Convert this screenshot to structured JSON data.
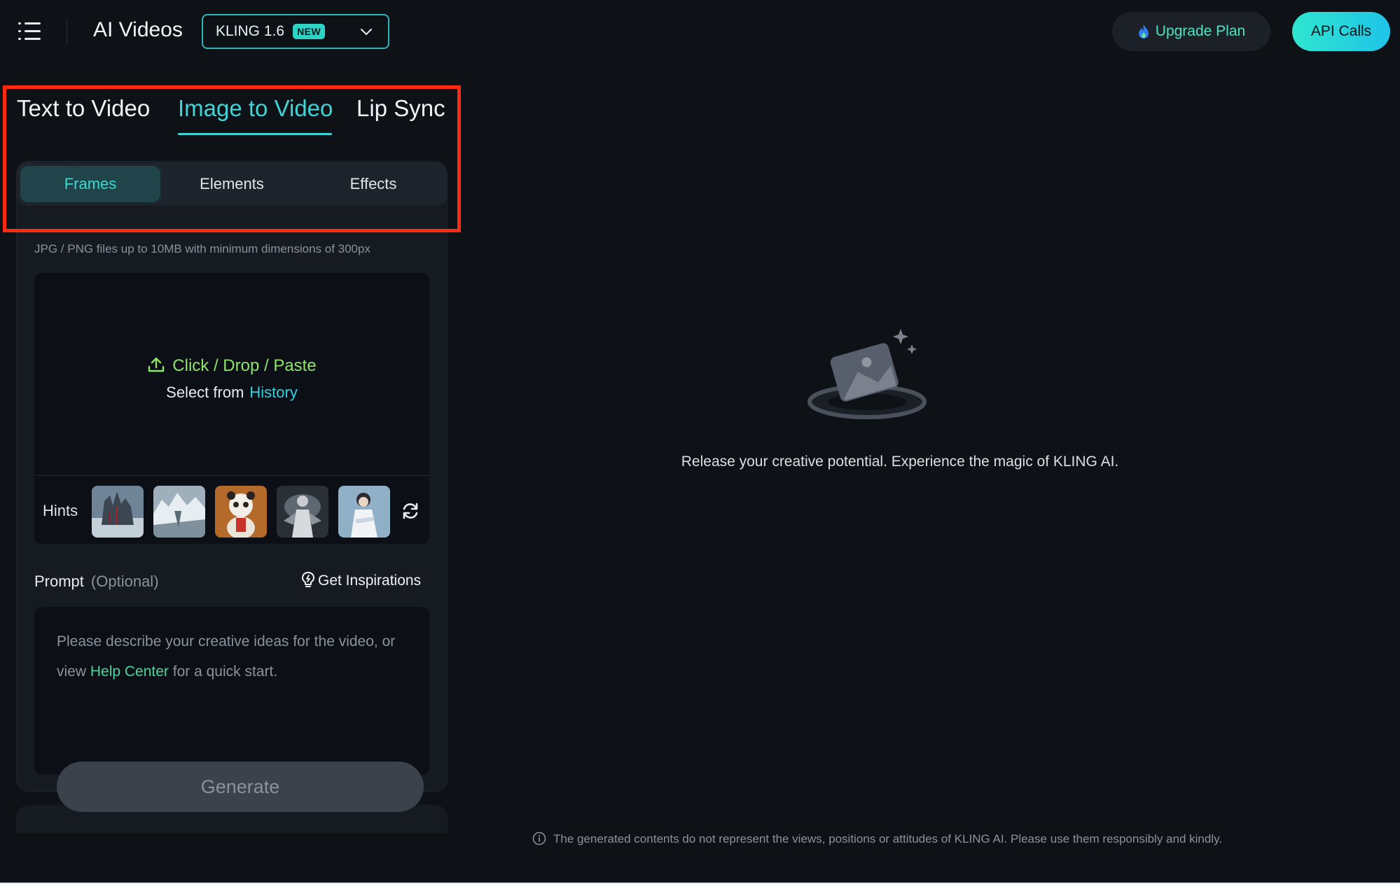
{
  "header": {
    "app_title": "AI Videos",
    "model": {
      "label": "KLING 1.6",
      "badge": "NEW"
    },
    "upgrade_label": "Upgrade Plan",
    "api_label": "API Calls"
  },
  "mode_tabs": [
    {
      "label": "Text to Video",
      "active": false
    },
    {
      "label": "Image to Video",
      "active": true
    },
    {
      "label": "Lip Sync",
      "active": false
    }
  ],
  "sub_tabs": [
    {
      "label": "Frames",
      "active": true
    },
    {
      "label": "Elements",
      "active": false
    },
    {
      "label": "Effects",
      "active": false
    }
  ],
  "upload": {
    "hint": "JPG / PNG files up to 10MB with minimum dimensions of 300px",
    "action_label": "Click / Drop / Paste",
    "select_prefix": "Select from",
    "history_link": "History"
  },
  "hints": {
    "label": "Hints",
    "thumbnails": [
      "hint-thumb-city",
      "hint-thumb-glacier",
      "hint-thumb-panda",
      "hint-thumb-figure",
      "hint-thumb-person"
    ]
  },
  "prompt": {
    "label": "Prompt",
    "optional": "(Optional)",
    "inspirations_label": "Get Inspirations",
    "placeholder_pre": "Please describe your creative ideas for the video, or view",
    "help_link": "Help Center",
    "placeholder_post": "for a quick start."
  },
  "generate_label": "Generate",
  "main": {
    "empty_message": "Release your creative potential. Experience the magic of KLING AI."
  },
  "footer_note": "The generated contents do not represent the views, positions or attitudes of KLING AI. Please use them responsibly and kindly.",
  "colors": {
    "accent": "#3fd5d8",
    "highlight": "#ff2a12",
    "background": "#0e1217",
    "panel": "#161b22"
  }
}
